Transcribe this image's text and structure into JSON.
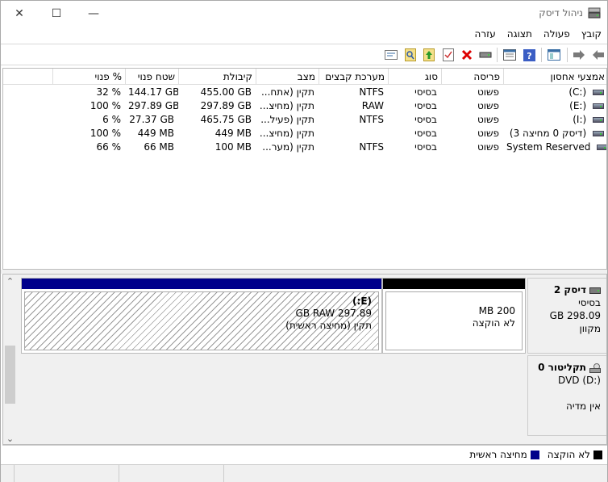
{
  "window": {
    "title": "ניהול דיסק",
    "minimize_glyph": "—",
    "maximize_glyph": "☐",
    "close_glyph": "✕"
  },
  "menu": [
    "קובץ",
    "פעולה",
    "תצוגה",
    "עזרה"
  ],
  "toolbar": {
    "icons": [
      "back-icon",
      "forward-icon",
      "console-tree-icon",
      "help-icon",
      "properties-icon",
      "rescan-icon",
      "delete-icon",
      "check-icon",
      "up-folder-icon",
      "search-icon",
      "export-list-icon"
    ]
  },
  "volumes": {
    "columns": [
      "אמצעי אחסון",
      "פריסה",
      "סוג",
      "מערכת קבצים",
      "מצב",
      "קיבולת",
      "שטח פנוי",
      "% פנוי"
    ],
    "rows": [
      [
        "(C:)",
        "פשוט",
        "בסיסי",
        "NTFS",
        "תקין (אתח...",
        "455.00 GB",
        "144.17 GB",
        "32 %"
      ],
      [
        "(E:)",
        "פשוט",
        "בסיסי",
        "RAW",
        "תקין (מחיצ...",
        "297.89 GB",
        "297.89 GB",
        "100 %"
      ],
      [
        "(I:)",
        "פשוט",
        "בסיסי",
        "NTFS",
        "תקין (פעיל...",
        "465.75 GB",
        "27.37 GB",
        "6 %"
      ],
      [
        "(דיסק 0 מחיצה 3)",
        "פשוט",
        "בסיסי",
        "",
        "תקין (מחיצ...",
        "449 MB",
        "449 MB",
        "100 %"
      ],
      [
        "System Reserved",
        "פשוט",
        "בסיסי",
        "NTFS",
        "תקין (מער...",
        "100 MB",
        "66 MB",
        "66 %"
      ]
    ]
  },
  "disks": {
    "disk2": {
      "name": "דיסק 2",
      "type": "בסיסי",
      "size": "298.09 GB",
      "status": "מקוון",
      "partitions": [
        {
          "size": "200 MB",
          "status": "לא הוקצה",
          "bar_color": "#000000"
        },
        {
          "label": "(E:)",
          "size": "297.89 GB RAW",
          "status": "תקין (מחיצה ראשית)",
          "bar_color": "#00008b"
        }
      ]
    },
    "cdrom0": {
      "name": "תקליטור 0",
      "type": "DVD (D:)",
      "status": "אין מדיה"
    }
  },
  "scroll": {
    "up_glyph": "⌃",
    "down_glyph": "⌄"
  },
  "legend": [
    {
      "label": "לא הוקצה",
      "color": "#000000"
    },
    {
      "label": "מחיצה ראשית",
      "color": "#00008b"
    }
  ]
}
